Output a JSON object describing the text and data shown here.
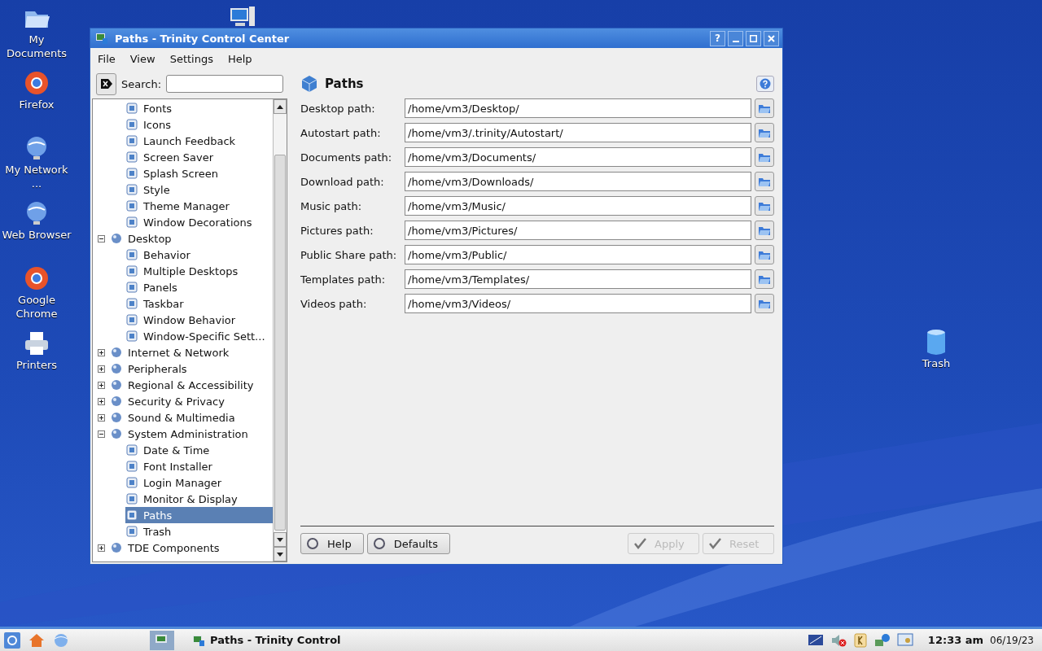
{
  "desktop_icons": [
    {
      "label": "My Documents",
      "kind": "folder"
    },
    {
      "label": "Firefox",
      "kind": "browser"
    },
    {
      "label": "My Network ...",
      "kind": "globe"
    },
    {
      "label": "Web Browser",
      "kind": "globe"
    },
    {
      "label": "Google Chrome",
      "kind": "browser"
    },
    {
      "label": "Printers",
      "kind": "printer"
    }
  ],
  "trash_icon": {
    "label": "Trash"
  },
  "window": {
    "title": "Paths - Trinity Control Center",
    "title_buttons": [
      "?"
    ]
  },
  "menu": [
    "File",
    "View",
    "Settings",
    "Help"
  ],
  "search": {
    "label": "Search:"
  },
  "tree": [
    {
      "children": [
        {
          "label": "Fonts",
          "selected": false
        },
        {
          "label": "Icons",
          "selected": false
        },
        {
          "label": "Launch Feedback",
          "selected": false
        },
        {
          "label": "Screen Saver",
          "selected": false
        },
        {
          "label": "Splash Screen",
          "selected": false
        },
        {
          "label": "Style",
          "selected": false
        },
        {
          "label": "Theme Manager",
          "selected": false
        },
        {
          "label": "Window Decorations",
          "selected": false
        }
      ]
    },
    {
      "label": "Desktop",
      "expanded": true,
      "selected": false,
      "children": [
        {
          "label": "Behavior",
          "selected": false
        },
        {
          "label": "Multiple Desktops",
          "selected": false
        },
        {
          "label": "Panels",
          "selected": false
        },
        {
          "label": "Taskbar",
          "selected": false
        },
        {
          "label": "Window Behavior",
          "selected": false
        },
        {
          "label": "Window-Specific Sett...",
          "selected": false
        }
      ]
    },
    {
      "label": "Internet & Network",
      "expanded": false,
      "selected": false
    },
    {
      "label": "Peripherals",
      "expanded": false,
      "selected": false
    },
    {
      "label": "Regional & Accessibility",
      "expanded": false,
      "selected": false
    },
    {
      "label": "Security & Privacy",
      "expanded": false,
      "selected": false
    },
    {
      "label": "Sound & Multimedia",
      "expanded": false,
      "selected": false
    },
    {
      "label": "System Administration",
      "expanded": true,
      "selected": false,
      "children": [
        {
          "label": "Date & Time",
          "selected": false
        },
        {
          "label": "Font Installer",
          "selected": false
        },
        {
          "label": "Login Manager",
          "selected": false
        },
        {
          "label": "Monitor & Display",
          "selected": false
        },
        {
          "label": "Paths",
          "selected": true
        },
        {
          "label": "Trash",
          "selected": false
        }
      ]
    },
    {
      "label": "TDE Components",
      "expanded": false,
      "selected": false
    }
  ],
  "page": {
    "title": "Paths",
    "paths": [
      {
        "label": "Desktop path:",
        "value": "/home/vm3/Desktop/"
      },
      {
        "label": "Autostart path:",
        "value": "/home/vm3/.trinity/Autostart/"
      },
      {
        "label": "Documents path:",
        "value": "/home/vm3/Documents/"
      },
      {
        "label": "Download path:",
        "value": "/home/vm3/Downloads/"
      },
      {
        "label": "Music path:",
        "value": "/home/vm3/Music/"
      },
      {
        "label": "Pictures path:",
        "value": "/home/vm3/Pictures/"
      },
      {
        "label": "Public Share path:",
        "value": "/home/vm3/Public/"
      },
      {
        "label": "Templates path:",
        "value": "/home/vm3/Templates/"
      },
      {
        "label": "Videos path:",
        "value": "/home/vm3/Videos/"
      }
    ]
  },
  "buttons_left": [
    {
      "label": "Help",
      "disabled": false
    },
    {
      "label": "Defaults",
      "disabled": false
    }
  ],
  "buttons_right": [
    {
      "label": "Apply",
      "disabled": true
    },
    {
      "label": "Reset",
      "disabled": true
    }
  ],
  "taskbar": {
    "task": "Paths - Trinity Control",
    "clock": "12:33 am",
    "date": "06/19/23"
  }
}
